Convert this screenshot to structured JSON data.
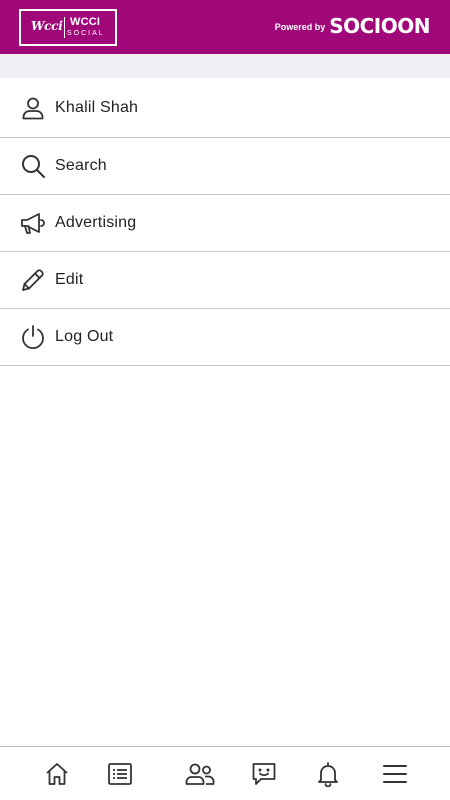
{
  "header": {
    "logo_script": "Wcci",
    "logo_title": "WCCI",
    "logo_subtitle": "SOCIAL",
    "powered_by": "Powered by",
    "brand": "SOCIOON",
    "background_color": "#a0087a"
  },
  "menu": {
    "items": [
      {
        "label": "Khalil Shah",
        "icon": "user-icon"
      },
      {
        "label": "Search",
        "icon": "search-icon"
      },
      {
        "label": "Advertising",
        "icon": "megaphone-icon"
      },
      {
        "label": "Edit",
        "icon": "pencil-icon"
      },
      {
        "label": "Log Out",
        "icon": "power-icon"
      }
    ]
  },
  "bottom_nav": {
    "items": [
      {
        "icon": "home-icon"
      },
      {
        "icon": "list-icon"
      },
      {
        "icon": "people-icon"
      },
      {
        "icon": "chat-icon"
      },
      {
        "icon": "bell-icon"
      },
      {
        "icon": "hamburger-menu-icon"
      }
    ]
  }
}
